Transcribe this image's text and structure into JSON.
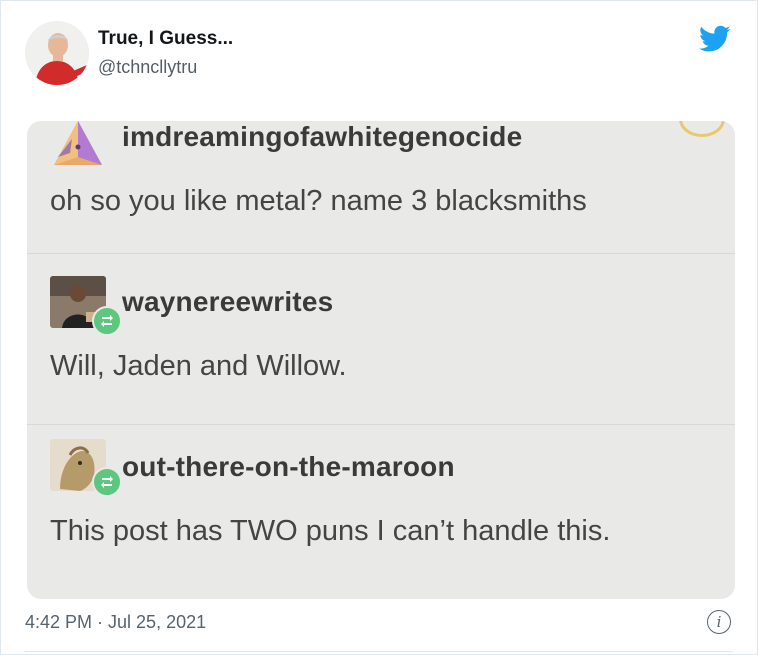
{
  "tweet": {
    "author_name": "True, I Guess...",
    "author_handle": "@tchncllytru",
    "timestamp": "4:42 PM · Jul 25, 2021",
    "platform_icon": "twitter-bird-icon",
    "info_icon": "info-icon"
  },
  "embed": {
    "posts": [
      {
        "username": "imdreamingofawhitegenocide",
        "text": "oh so you like metal? name 3 blacksmiths",
        "avatar_icon": "pyramid-avatar"
      },
      {
        "username": "waynereewrites",
        "text": "Will, Jaden and Willow.",
        "avatar_icon": "photo-avatar"
      },
      {
        "username": "out-there-on-the-maroon",
        "text": "This post has TWO puns I can’t handle this.",
        "avatar_icon": "dog-avatar"
      }
    ]
  },
  "colors": {
    "twitter_blue": "#1da1f2",
    "reblog_green": "#5dc67f",
    "embed_background": "#e9e9e7"
  }
}
